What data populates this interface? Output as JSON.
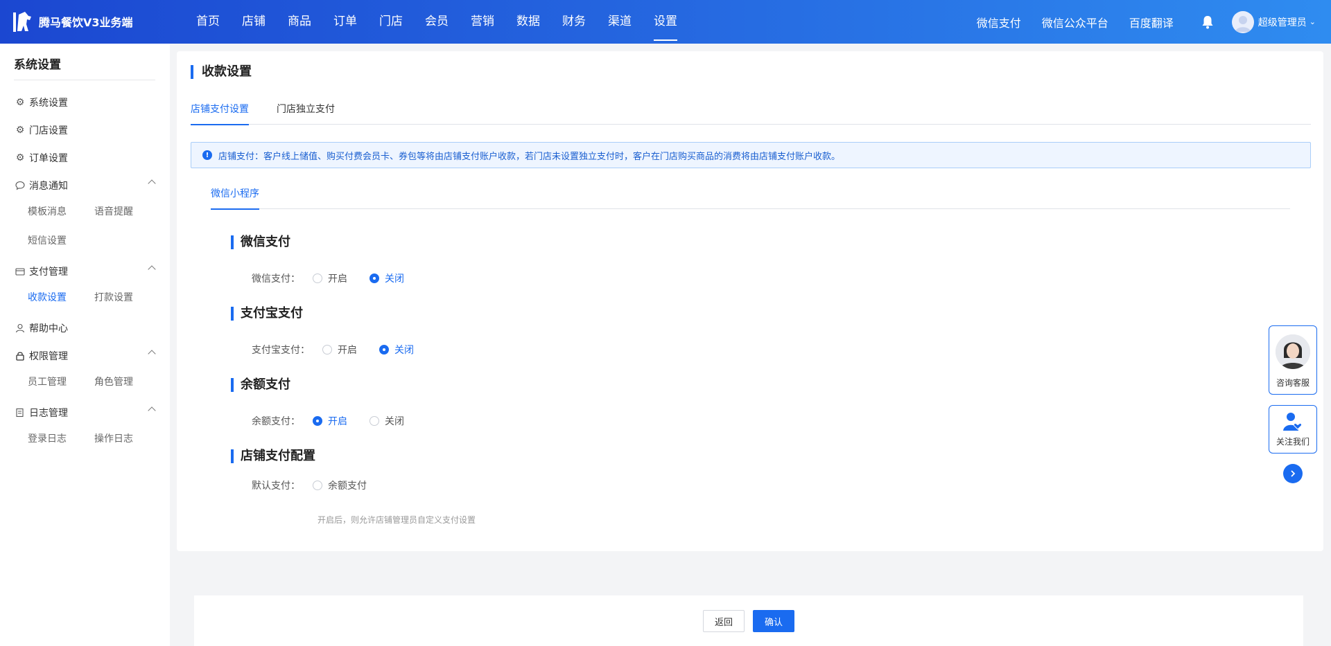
{
  "app": {
    "title": "腾马餐饮V3业务端"
  },
  "topnav": {
    "items": [
      "首页",
      "店铺",
      "商品",
      "订单",
      "门店",
      "会员",
      "营销",
      "数据",
      "财务",
      "渠道",
      "设置"
    ],
    "active_index": 10,
    "right_links": [
      "微信支付",
      "微信公众平台",
      "百度翻译"
    ],
    "user_name": "超级管理员"
  },
  "sidebar": {
    "title": "系统设置",
    "items": [
      {
        "label": "系统设置",
        "icon": "gear-icon"
      },
      {
        "label": "门店设置",
        "icon": "gear-icon"
      },
      {
        "label": "订单设置",
        "icon": "gear-icon"
      },
      {
        "label": "消息通知",
        "icon": "chat-icon",
        "sub": [
          "模板消息",
          "语音提醒",
          "短信设置"
        ]
      },
      {
        "label": "支付管理",
        "icon": "wallet-icon",
        "sub": [
          "收款设置",
          "打款设置"
        ]
      },
      {
        "label": "帮助中心",
        "icon": "user-icon"
      },
      {
        "label": "权限管理",
        "icon": "lock-icon",
        "sub": [
          "员工管理",
          "角色管理"
        ]
      },
      {
        "label": "日志管理",
        "icon": "log-icon",
        "sub": [
          "登录日志",
          "操作日志"
        ]
      }
    ],
    "active_sub": "收款设置"
  },
  "page": {
    "title": "收款设置",
    "tabs": [
      "店铺支付设置",
      "门店独立支付"
    ],
    "active_tab": 0,
    "alert": "店铺支付：客户线上储值、购买付费会员卡、券包等将由店铺支付账户收款，若门店未设置独立支付时，客户在门店购买商品的消费将由店铺支付账户收款。",
    "subtab": "微信小程序",
    "sections": [
      {
        "heading": "微信支付",
        "label": "微信支付：",
        "options": [
          "开启",
          "关闭"
        ],
        "selected": "关闭"
      },
      {
        "heading": "支付宝支付",
        "label": "支付宝支付：",
        "options": [
          "开启",
          "关闭"
        ],
        "selected": "关闭"
      },
      {
        "heading": "余额支付",
        "label": "余额支付：",
        "options": [
          "开启",
          "关闭"
        ],
        "selected": "开启"
      },
      {
        "heading": "店铺支付配置",
        "label": "默认支付：",
        "options": [
          "余额支付"
        ],
        "selected": ""
      }
    ],
    "hint": "开启后，则允许店铺管理员自定义支付设置"
  },
  "footer": {
    "back_label": "返回",
    "confirm_label": "确认"
  },
  "float": {
    "consult_label": "咨询客服",
    "follow_label": "关注我们"
  },
  "colors": {
    "primary": "#1a6bf0",
    "nav_start": "#1b47d1",
    "nav_end": "#2f8cf0"
  }
}
